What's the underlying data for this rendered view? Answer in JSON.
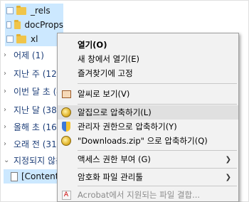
{
  "explorer": {
    "folders": [
      {
        "label": "_rels"
      },
      {
        "label": "docProps"
      },
      {
        "label": "xl"
      }
    ],
    "groups": [
      {
        "label": "어제 (1)"
      },
      {
        "label": "지난 주 (12)"
      },
      {
        "label": "이번 달 초 (4)"
      },
      {
        "label": "지난 달 (38)"
      },
      {
        "label": "올해 초 (166)"
      },
      {
        "label": "오래 전 (319)"
      },
      {
        "label": "지정되지 않음"
      }
    ],
    "selected_file": {
      "label": "[Content_T"
    }
  },
  "context_menu": {
    "items": [
      {
        "label": "열기(O)",
        "bold": true,
        "icon": ""
      },
      {
        "label": "새 창에서 열기(E)",
        "bold": false,
        "icon": ""
      },
      {
        "label": "즐겨찾기에 고정",
        "bold": false,
        "icon": ""
      },
      {
        "label": "알씨로 보기(V)",
        "bold": false,
        "icon": "preview-icon"
      },
      {
        "label": "알집으로 압축하기(L)",
        "bold": false,
        "icon": "alzip-icon",
        "hover": true
      },
      {
        "label": "관리자 권한으로 압축하기(Y)",
        "bold": false,
        "icon": "admin-shield-icon"
      },
      {
        "label": "\"Downloads.zip\" 으로 압축하기(Q)",
        "bold": false,
        "icon": "alzip-icon"
      },
      {
        "label": "액세스 권한 부여 (G)",
        "bold": false,
        "icon": "",
        "submenu": true
      },
      {
        "label": "암호화 파일 관리툴",
        "bold": false,
        "icon": "",
        "submenu": true
      },
      {
        "label": "Acrobat에서 지원되는 파일 결합...",
        "bold": false,
        "icon": "acrobat-icon",
        "disabled": true
      }
    ]
  },
  "colors": {
    "selection": "#cce8ff",
    "group_text": "#1e3f79",
    "menu_bg": "#f2f2f2"
  }
}
